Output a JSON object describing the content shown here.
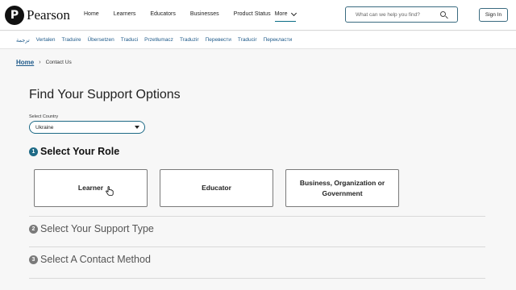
{
  "brand": {
    "name": "Pearson",
    "mark": "P"
  },
  "nav": {
    "items": [
      "Home",
      "Learners",
      "Educators",
      "Businesses",
      "Product Status"
    ],
    "more_label": "More"
  },
  "search": {
    "placeholder": "What can we help you find?"
  },
  "signin_label": "Sign In",
  "languages": [
    "ترجمة",
    "Vertalen",
    "Traduire",
    "Übersetzen",
    "Traduci",
    "Przetłumacz",
    "Traduzir",
    "Перевести",
    "Traducir",
    "Перекласти"
  ],
  "breadcrumb": {
    "home": "Home",
    "separator": "›",
    "current": "Contact Us"
  },
  "page_title": "Find Your Support Options",
  "country": {
    "label": "Select Country",
    "value": "Ukraine"
  },
  "steps": [
    {
      "number": "1",
      "title": "Select Your Role",
      "state": "active"
    },
    {
      "number": "2",
      "title": "Select Your Support Type",
      "state": "inactive"
    },
    {
      "number": "3",
      "title": "Select A Contact Method",
      "state": "inactive"
    }
  ],
  "roles": [
    "Learner",
    "Educator",
    "Business, Organization or Government"
  ],
  "colors": {
    "accent": "#1e6a86",
    "link": "#1e5a8a",
    "inactive_step": "#7a7a7a"
  },
  "icons": {
    "search": "search-icon",
    "more": "chevron-down-icon",
    "select": "caret-down-icon",
    "cursor": "hand-pointer-icon"
  }
}
